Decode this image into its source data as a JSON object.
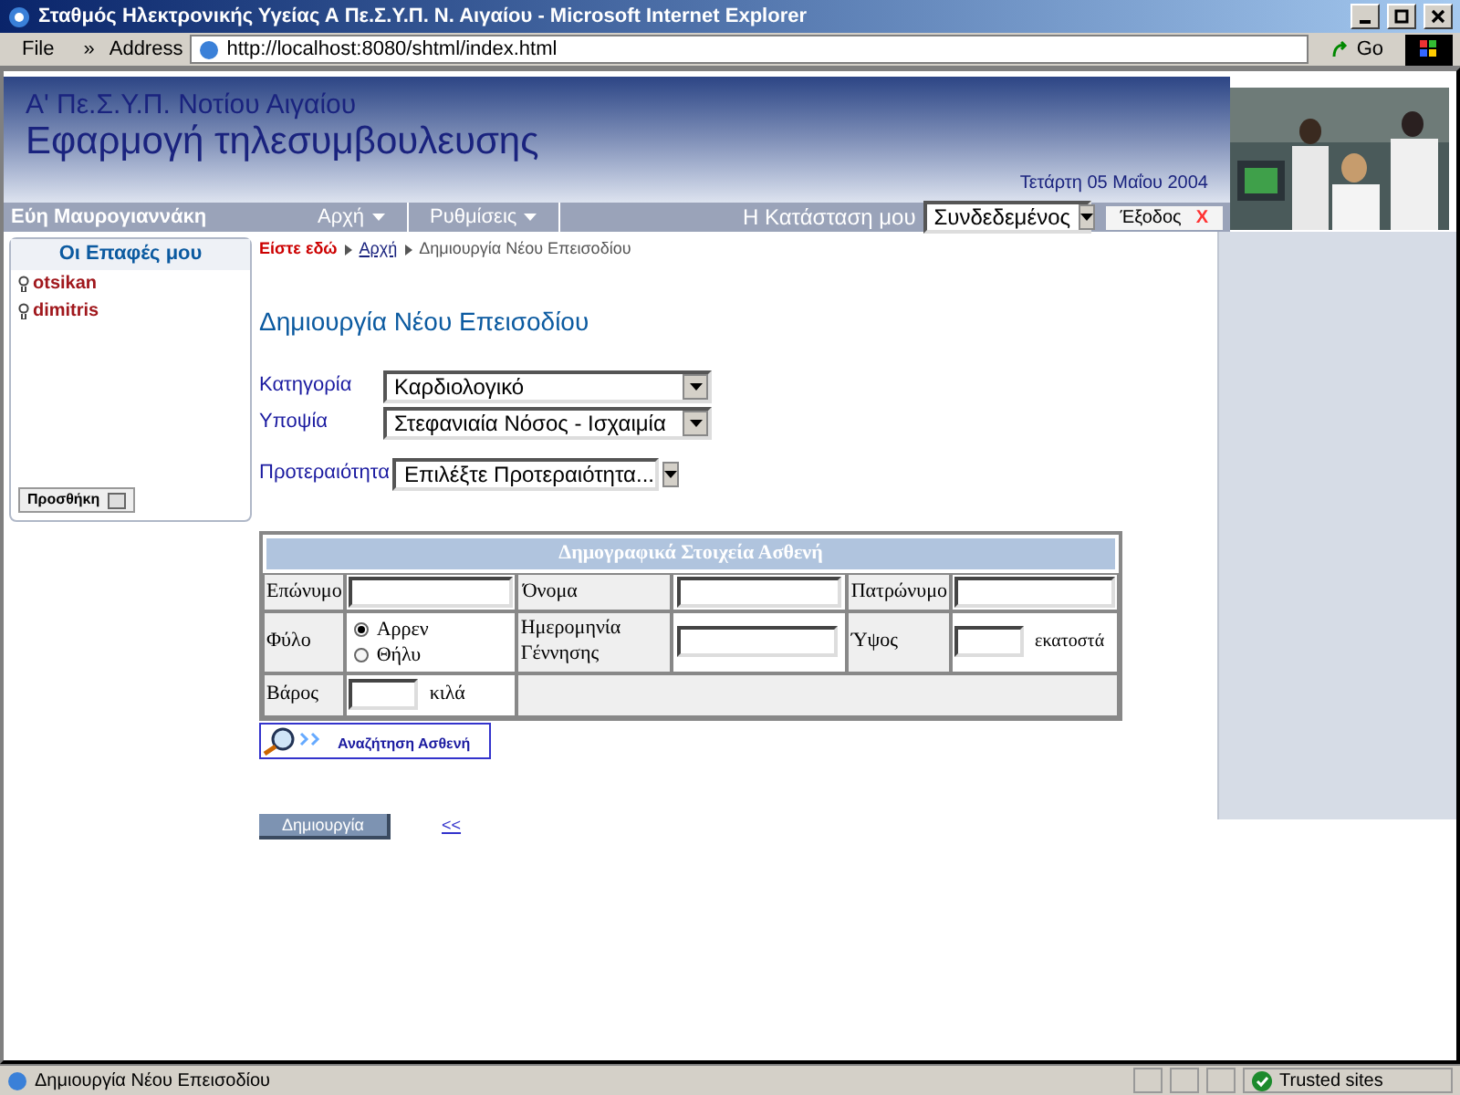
{
  "window": {
    "title": "Σταθμός Ηλεκτρονικής Υγείας Α Πε.Σ.Υ.Π. Ν. Αιγαίου - Microsoft Internet Explorer"
  },
  "toolbar": {
    "menu": "File",
    "chevron": "»",
    "address_label": "Address",
    "url": "http://localhost:8080/shtml/index.html",
    "go": "Go"
  },
  "header": {
    "org": "Α' Πε.Σ.Υ.Π. Νοτίου Αιγαίου",
    "app": "Εφαρμογή τηλεσυμβουλευσης",
    "date": "Τετάρτη 05 Μαΐου 2004"
  },
  "navbar": {
    "user": "Εύη Μαυρογιαννάκη",
    "menus": [
      {
        "label": "Αρχή",
        "dropdown": true
      },
      {
        "label": "Ρυθμίσεις",
        "dropdown": true
      }
    ],
    "status_label": "Η Κατάσταση μου",
    "status_value": "Συνδεδεμένος",
    "logout": "Έξοδος",
    "logout_mark": "X"
  },
  "contacts": {
    "title": "Οι Επαφές μου",
    "items": [
      {
        "name": "otsikan"
      },
      {
        "name": "dimitris"
      }
    ],
    "add": "Προσθήκη"
  },
  "breadcrumb": {
    "label": "Είστε εδώ",
    "items": [
      {
        "text": "Αρχή",
        "link": true
      },
      {
        "text": "Δημιουργία Νέου Επεισοδίου",
        "link": false
      }
    ]
  },
  "page_title": "Δημιουργία Νέου Επεισοδίου",
  "fields": [
    {
      "label": "Κατηγορία",
      "value": "Καρδιολογικό"
    },
    {
      "label": "Υποψία",
      "value": "Στεφανιαία Νόσος - Ισχαιμία"
    },
    {
      "label": "Προτεραιότητα",
      "value": "Επιλέξτε Προτεραιότητα..."
    }
  ],
  "demographics": {
    "title": "Δημογραφικά Στοιχεία Ασθενή",
    "surname": "Επώνυμο",
    "name": "Όνομα",
    "father": "Πατρώνυμο",
    "sex": "Φύλο",
    "sex_options": [
      {
        "label": "Αρρεν",
        "selected": true
      },
      {
        "label": "Θήλυ",
        "selected": false
      }
    ],
    "birth": "Ημερομηνία Γέννησης",
    "height": "Ύψος",
    "height_unit": "εκατοστά",
    "weight": "Βάρος",
    "weight_unit": "κιλά"
  },
  "search_button": "Αναζήτηση Ασθενή",
  "create_button": "Δημιουργία",
  "back_link": "<<",
  "status_bar": {
    "text": "Δημιουργία Νέου Επεισοδίου",
    "zone": "Trusted sites"
  }
}
